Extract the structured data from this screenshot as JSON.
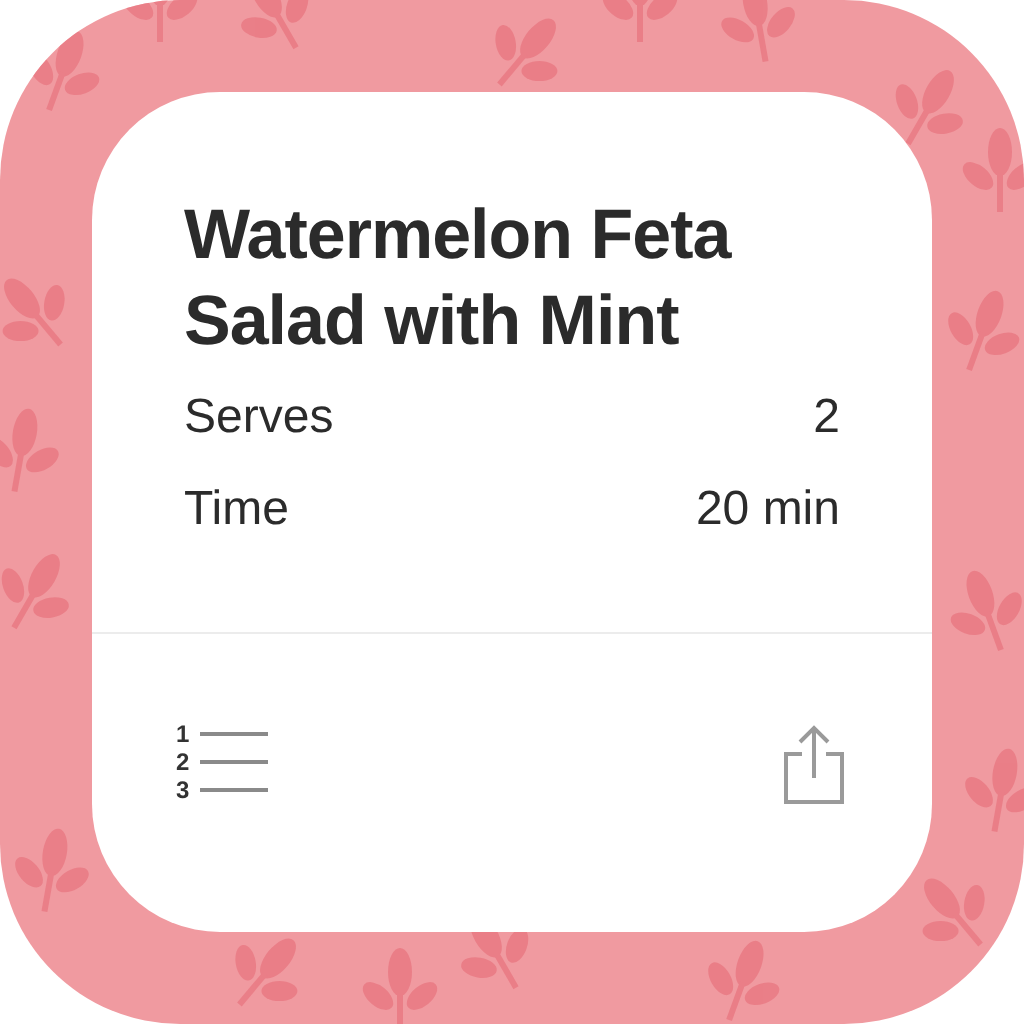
{
  "recipe": {
    "title": "Watermelon Feta Salad with Mint",
    "details": [
      {
        "label": "Serves",
        "value": "2"
      },
      {
        "label": "Time",
        "value": "20 min"
      }
    ]
  },
  "toolbar": {
    "list_numbers": [
      "1",
      "2",
      "3"
    ]
  }
}
